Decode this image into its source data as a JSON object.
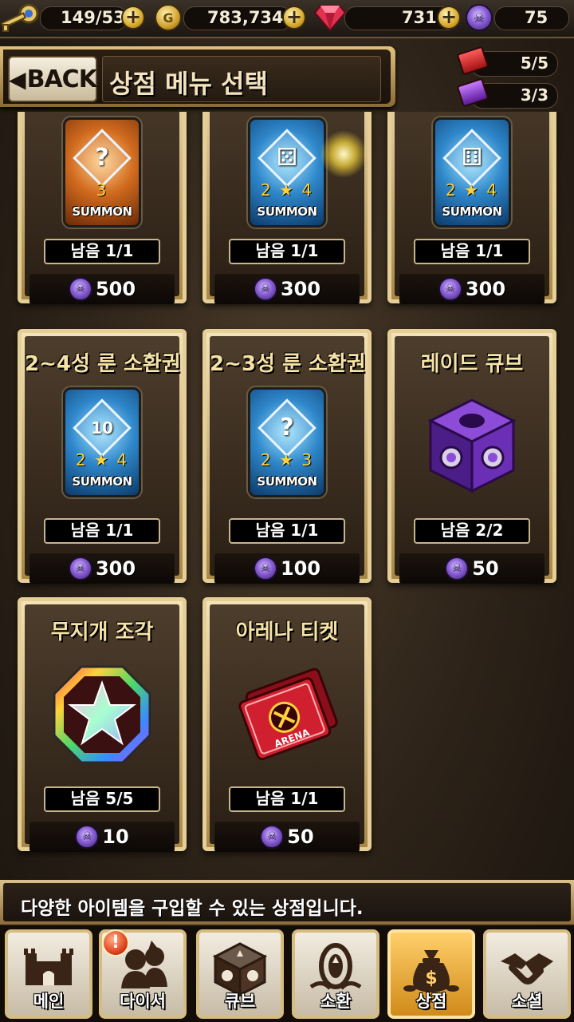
{
  "resources": {
    "stamina": "149/53",
    "gold": "783,734",
    "gems": "731",
    "skull_coins": "75",
    "gold_symbol": "G"
  },
  "header": {
    "back_label": "BACK",
    "title": "상점 메뉴 선택"
  },
  "ticket_counters": {
    "red": "5/5",
    "purple": "3/3"
  },
  "items": [
    {
      "name": "",
      "remaining": "남음 1/1",
      "price": "500",
      "summon_stars": "3",
      "summon_label": "SUMMON",
      "glyph": "?"
    },
    {
      "name": "",
      "remaining": "남음 1/1",
      "price": "300",
      "summon_stars": "2 ★ 4",
      "summon_label": "SUMMON",
      "glyph": "⚄"
    },
    {
      "name": "",
      "remaining": "남음 1/1",
      "price": "300",
      "summon_stars": "2 ★ 4",
      "summon_label": "SUMMON",
      "glyph": "⚅"
    },
    {
      "name": "2~4성 룬 소환권",
      "remaining": "남음 1/1",
      "price": "300",
      "summon_stars": "2 ★ 4",
      "summon_label": "SUMMON",
      "glyph": "10"
    },
    {
      "name": "2~3성 룬 소환권",
      "remaining": "남음 1/1",
      "price": "100",
      "summon_stars": "2 ★ 3",
      "summon_label": "SUMMON",
      "glyph": "?"
    },
    {
      "name": "레이드 큐브",
      "remaining": "남음 2/2",
      "price": "50"
    },
    {
      "name": "무지개 조각",
      "remaining": "남음 5/5",
      "price": "10"
    },
    {
      "name": "아레나 티켓",
      "remaining": "남음 1/1",
      "price": "50",
      "arena_text": "ARENA"
    }
  ],
  "info_text": "다양한 아이템을 구입할 수 있는 상점입니다.",
  "nav": [
    {
      "label": "메인",
      "icon": "castle-icon"
    },
    {
      "label": "다이서",
      "icon": "heroes-icon",
      "alert": "!"
    },
    {
      "label": "큐브",
      "icon": "cube-icon"
    },
    {
      "label": "소환",
      "icon": "summon-icon"
    },
    {
      "label": "상점",
      "icon": "money-bag-icon",
      "active": true
    },
    {
      "label": "소셜",
      "icon": "handshake-icon"
    }
  ],
  "colors": {
    "card_border": "#e6cf97",
    "active_nav": "#f0a830",
    "skull_coin": "#8b5fd6",
    "gem": "#e0314f"
  }
}
